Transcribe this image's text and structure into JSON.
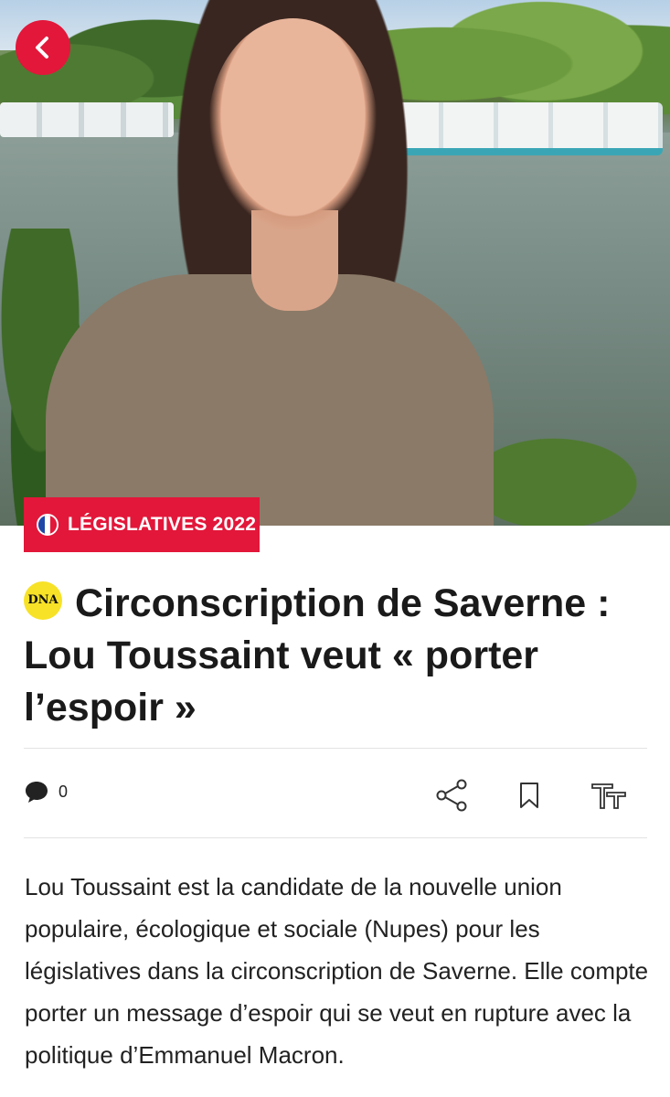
{
  "header": {
    "back_icon": "chevron-left-icon",
    "accent_color": "#e2173a"
  },
  "hero": {
    "tag_label": "LÉGISLATIVES 2022",
    "tag_icon": "french-flag-icon"
  },
  "article": {
    "source_logo": "DNA",
    "title": "Circonscription de Saverne : Lou Toussaint veut « porter l’espoir »",
    "comment_count": "0",
    "lead": "Lou Toussaint est la candidate de la nouvelle union populaire, écologique et sociale (Nupes) pour les législatives dans la circonscription de Saverne. Elle compte porter un message d’espoir qui se veut en rupture avec la politique d’Emmanuel Macron."
  },
  "toolbar": {
    "comment_icon": "comment-bubble-icon",
    "share_icon": "share-icon",
    "bookmark_icon": "bookmark-icon",
    "text_size_icon": "text-size-icon"
  }
}
